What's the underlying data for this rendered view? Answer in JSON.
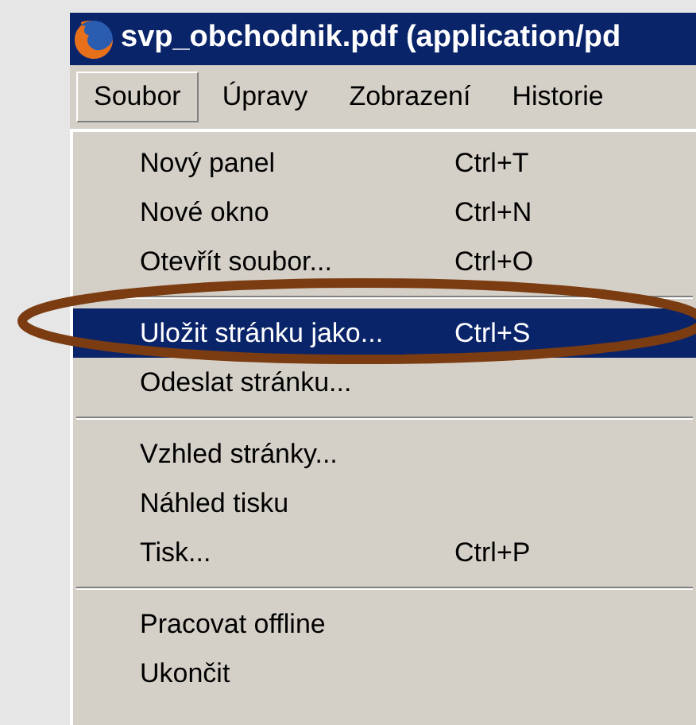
{
  "window": {
    "title": "svp_obchodnik.pdf (application/pd"
  },
  "menubar": [
    {
      "label": "Soubor",
      "selected": true
    },
    {
      "label": "Úpravy",
      "selected": false
    },
    {
      "label": "Zobrazení",
      "selected": false
    },
    {
      "label": "Historie",
      "selected": false
    }
  ],
  "menu": [
    {
      "kind": "item",
      "label": "Nový panel",
      "shortcut": "Ctrl+T",
      "selected": false
    },
    {
      "kind": "item",
      "label": "Nové okno",
      "shortcut": "Ctrl+N",
      "selected": false
    },
    {
      "kind": "item",
      "label": "Otevřít soubor...",
      "shortcut": "Ctrl+O",
      "selected": false
    },
    {
      "kind": "separator"
    },
    {
      "kind": "item",
      "label": "Uložit stránku jako...",
      "shortcut": "Ctrl+S",
      "selected": true
    },
    {
      "kind": "item",
      "label": "Odeslat stránku...",
      "selected": false
    },
    {
      "kind": "separator"
    },
    {
      "kind": "item",
      "label": "Vzhled stránky...",
      "selected": false
    },
    {
      "kind": "item",
      "label": "Náhled tisku",
      "selected": false
    },
    {
      "kind": "item",
      "label": "Tisk...",
      "shortcut": "Ctrl+P",
      "selected": false
    },
    {
      "kind": "separator"
    },
    {
      "kind": "item",
      "label": "Pracovat offline",
      "selected": false
    },
    {
      "kind": "item",
      "label": "Ukončit",
      "selected": false
    }
  ],
  "annotations": [
    {
      "kind": "ellipse",
      "color": "#7b3c12"
    }
  ]
}
